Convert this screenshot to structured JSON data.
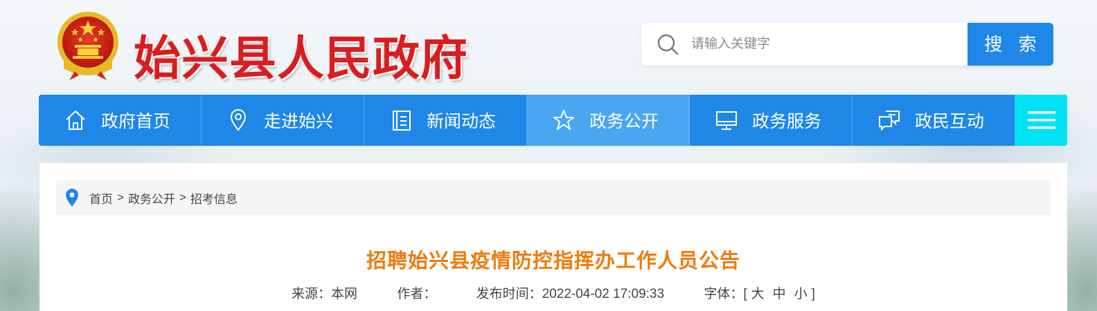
{
  "header": {
    "site_title": "始兴县人民政府"
  },
  "search": {
    "placeholder": "请输入关键字",
    "button_label": "搜 索"
  },
  "nav": {
    "items": [
      {
        "label": "政府首页",
        "icon": "home-icon"
      },
      {
        "label": "走进始兴",
        "icon": "location-pin-icon"
      },
      {
        "label": "新闻动态",
        "icon": "news-document-icon"
      },
      {
        "label": "政务公开",
        "icon": "star-icon"
      },
      {
        "label": "政务服务",
        "icon": "monitor-icon"
      },
      {
        "label": "政民互动",
        "icon": "chat-bubbles-icon"
      }
    ],
    "active_index": 3,
    "menu_icon": "hamburger-menu-icon"
  },
  "breadcrumb": {
    "items": [
      "首页",
      "政务公开",
      "招考信息"
    ],
    "separator": ">"
  },
  "article": {
    "title": "招聘始兴县疫情防控指挥办工作人员公告",
    "meta": {
      "source_label": "来源：本网",
      "author_label": "作者：",
      "publish_label": "发布时间：2022-04-02 17:09:33",
      "font_label": "字体：[",
      "font_large": "大",
      "font_medium": "中",
      "font_small": "小",
      "font_close": "]"
    }
  },
  "colors": {
    "nav_blue": "#1f87e8",
    "nav_active": "#4aa6f2",
    "menu_cyan": "#00e1f5",
    "title_red": "#d81e1e",
    "article_title_orange": "#f07a0a"
  }
}
